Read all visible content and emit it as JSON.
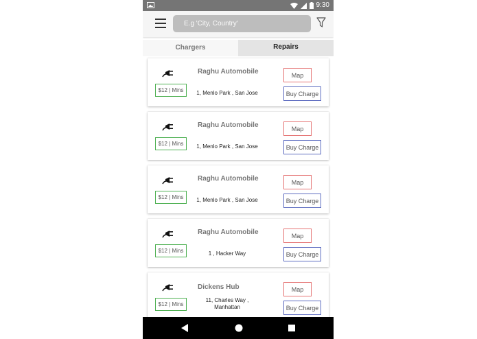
{
  "status_bar": {
    "time": "9:30",
    "icons": [
      "image-notification-icon",
      "wifi-icon",
      "signal-icon",
      "battery-icon"
    ]
  },
  "toolbar": {
    "search_placeholder": "E.g 'City, Country'",
    "menu_icon": "hamburger-menu-icon",
    "filter_icon": "filter-funnel-icon"
  },
  "tabs": [
    {
      "label": "Chargers"
    },
    {
      "label": "Repairs"
    }
  ],
  "listings": [
    {
      "name": "Raghu Automobile",
      "price": "$12 | Mins",
      "address": "1, Menlo Park , San Jose",
      "map_label": "Map",
      "buy_label": "Buy Charge"
    },
    {
      "name": "Raghu Automobile",
      "price": "$12 | Mins",
      "address": "1, Menlo Park , San Jose",
      "map_label": "Map",
      "buy_label": "Buy Charge"
    },
    {
      "name": "Raghu Automobile",
      "price": "$12 | Mins",
      "address": "1, Menlo Park , San Jose",
      "map_label": "Map",
      "buy_label": "Buy Charge"
    },
    {
      "name": "Raghu Automobile",
      "price": "$12 | Mins",
      "address": "1 , Hacker Way",
      "map_label": "Map",
      "buy_label": "Buy Charge"
    },
    {
      "name": "Dickens Hub",
      "price": "$12 | Mins",
      "address": "11, Charles Way , Manhattan",
      "map_label": "Map",
      "buy_label": "Buy Charge"
    }
  ],
  "nav_bar": {
    "icons": [
      "back-triangle-icon",
      "home-circle-icon",
      "recents-square-icon"
    ]
  },
  "colors": {
    "price_border": "#4caf50",
    "map_border": "#e57373",
    "buy_border": "#5c6bc0",
    "status_bar": "#757575",
    "search_bg": "#bdbdbd"
  }
}
